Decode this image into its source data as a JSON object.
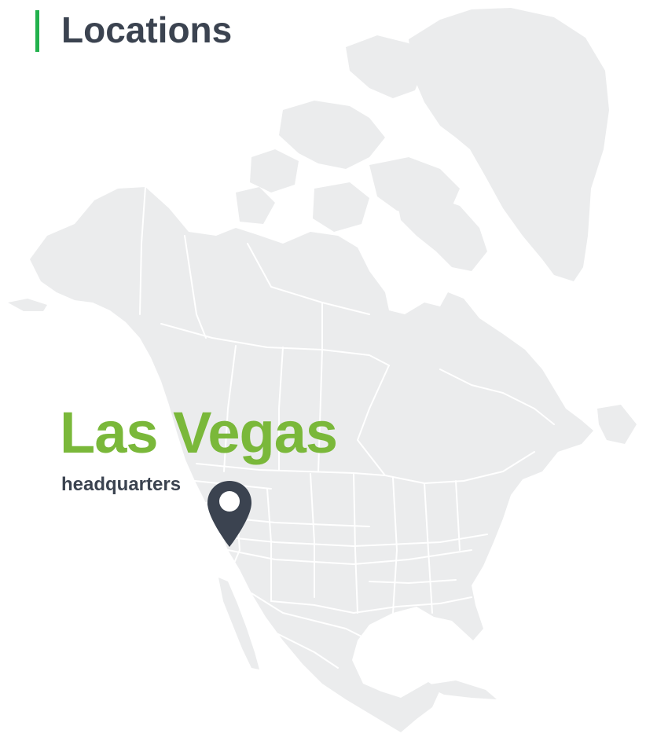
{
  "header": {
    "title": "Locations"
  },
  "location": {
    "city": "Las Vegas",
    "label": "headquarters"
  },
  "map": {
    "region": "North America",
    "marker_icon": "map-pin-icon"
  },
  "colors": {
    "accent_bar": "#22b14c",
    "title_text": "#3b4350",
    "city_text": "#7ab83a",
    "land": "#ebeced",
    "borders": "#ffffff",
    "marker": "#3b4350"
  }
}
